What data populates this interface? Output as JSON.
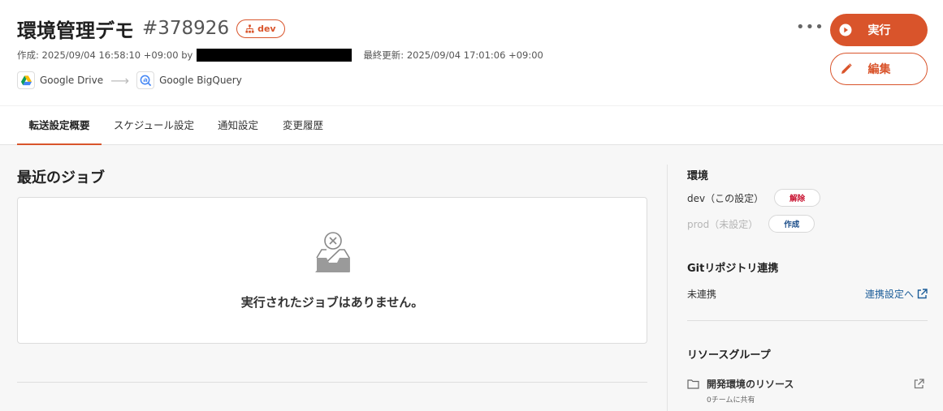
{
  "header": {
    "title": "環境管理デモ",
    "job_id": "#378926",
    "env_badge": "dev",
    "created_label": "作成: 2025/09/04 16:58:10 +09:00 by",
    "updated_label": "最終更新: 2025/09/04 17:01:06 +09:00",
    "source": "Google Drive",
    "destination": "Google BigQuery",
    "run_label": "実行",
    "edit_label": "編集",
    "more_label": "•••"
  },
  "tabs": [
    {
      "label": "転送設定概要",
      "active": true
    },
    {
      "label": "スケジュール設定",
      "active": false
    },
    {
      "label": "通知設定",
      "active": false
    },
    {
      "label": "変更履歴",
      "active": false
    }
  ],
  "main": {
    "section_title": "最近のジョブ",
    "empty_message": "実行されたジョブはありません。"
  },
  "sidebar": {
    "env_title": "環境",
    "envs": [
      {
        "name": "dev（この設定）",
        "action": "解除"
      },
      {
        "name": "prod（未設定）",
        "action": "作成"
      }
    ],
    "git_title": "Gitリポジトリ連携",
    "git_status": "未連携",
    "git_link": "連携設定へ",
    "rg_title": "リソースグループ",
    "rg_name": "開発環境のリソース",
    "rg_sub": "0チームに共有"
  },
  "colors": {
    "accent": "#d9542b",
    "danger": "#c8102e",
    "link": "#1c5d99"
  },
  "icons": {
    "env_badge": "sitemap-icon",
    "source": "google-drive-icon",
    "destination": "bigquery-icon",
    "run": "play-circle-icon",
    "edit": "pencil-icon",
    "empty": "empty-inbox-icon",
    "external": "external-link-icon",
    "folder": "folder-icon"
  }
}
